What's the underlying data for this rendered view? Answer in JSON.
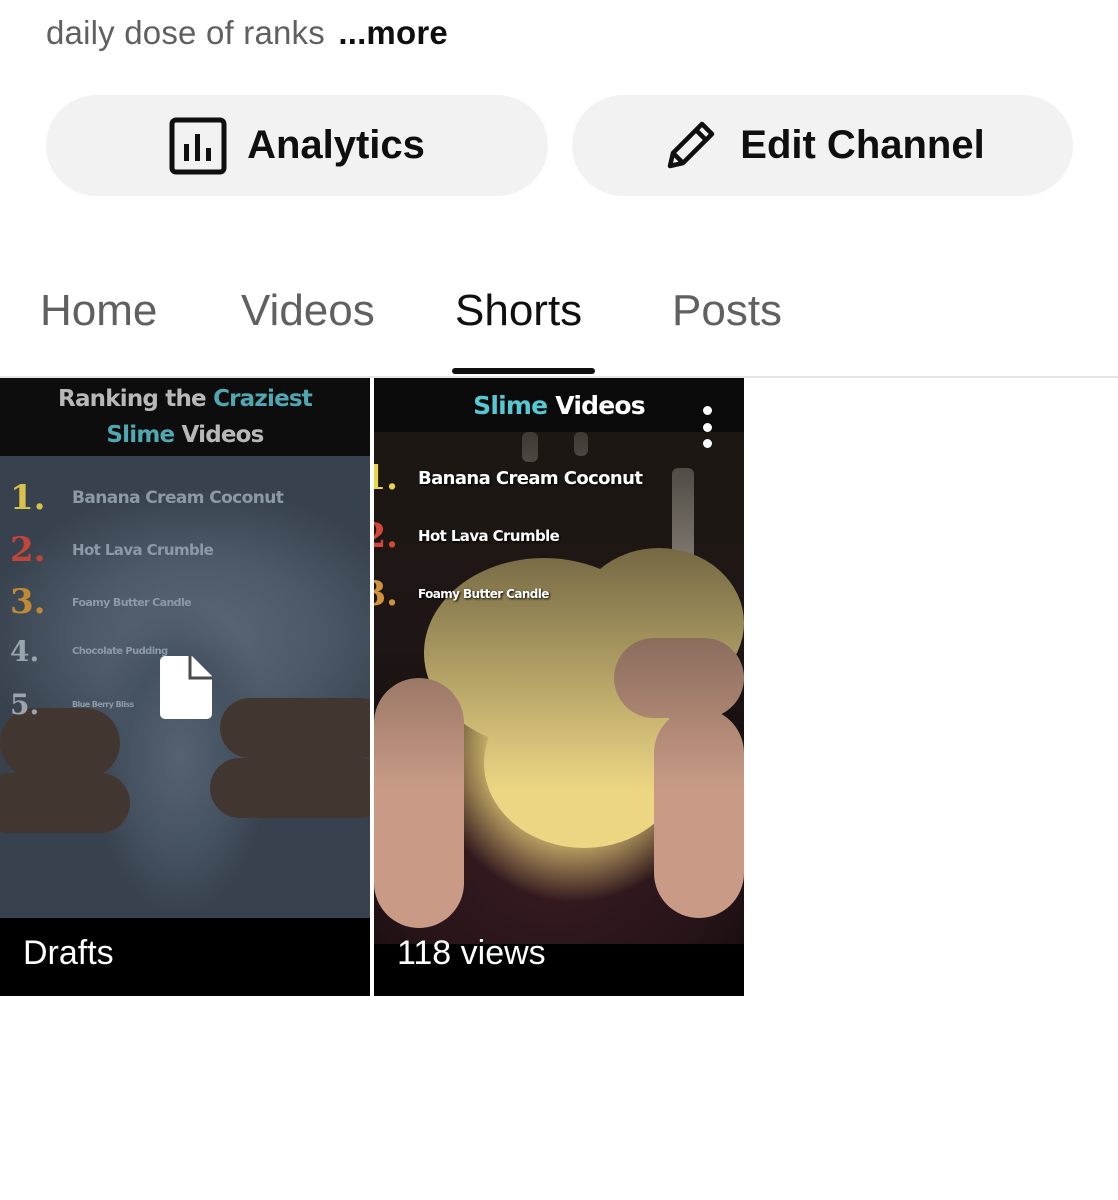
{
  "channel": {
    "description": "daily dose of ranks",
    "more_label": "...more"
  },
  "actions": {
    "analytics_label": "Analytics",
    "analytics_icon": "bar-chart-icon",
    "edit_label": "Edit Channel",
    "edit_icon": "pencil-icon"
  },
  "tabs": [
    {
      "label": "Home",
      "active": false
    },
    {
      "label": "Videos",
      "active": false
    },
    {
      "label": "Shorts",
      "active": true
    },
    {
      "label": "Posts",
      "active": false
    }
  ],
  "shorts": [
    {
      "status": "Drafts",
      "thumbnail": {
        "title_line1_prefix": "Ranking the",
        "title_line1_highlight": "Craziest",
        "title_line2_highlight": "Slime",
        "title_line2_suffix": "Videos",
        "ranks": [
          {
            "num": "1.",
            "label": "Banana Cream Coconut",
            "color": "#d9c24a"
          },
          {
            "num": "2.",
            "label": "Hot Lava Crumble",
            "color": "#c0463a"
          },
          {
            "num": "3.",
            "label": "Foamy Butter Candle",
            "color": "#c08a34"
          },
          {
            "num": "4.",
            "label": "Chocolate Pudding",
            "color": "#9aa4ad"
          },
          {
            "num": "5.",
            "label": "Blue Berry Bliss",
            "color": "#9aa4ad"
          }
        ],
        "overlay_icon": "document-icon"
      }
    },
    {
      "views": "118 views",
      "menu_icon": "more-vertical-icon",
      "thumbnail": {
        "title_highlight": "Slime",
        "title_suffix": "Videos",
        "ranks": [
          {
            "num": "1.",
            "label": "Banana Cream Coconut",
            "color": "#e9d64a"
          },
          {
            "num": "2.",
            "label": "Hot Lava Crumble",
            "color": "#d2473a"
          },
          {
            "num": "3.",
            "label": "Foamy Butter Candle",
            "color": "#d0933a"
          }
        ]
      }
    }
  ],
  "colors": {
    "background": "#ffffff",
    "pill_background": "#f2f2f2",
    "active_tab": "#0f0f0f",
    "inactive_tab": "#606060",
    "slime_title_accent": "#56c7d3"
  }
}
